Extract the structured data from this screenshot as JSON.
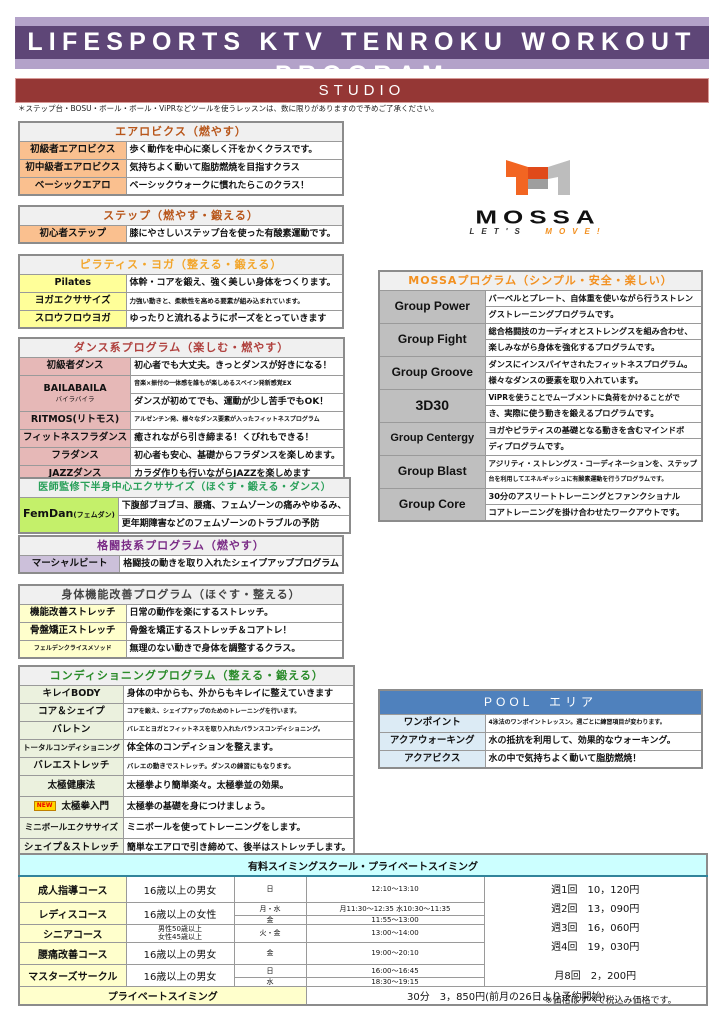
{
  "title": "LIFESPORTS KTV TENROKU WORKOUT PROGRAM",
  "studio": {
    "label": "STUDIO",
    "note": "＊ステップ台・BOSU・ボール・ボール・ViPRなどツールを使うレッスンは、数に限りがありますので予めご了承ください。"
  },
  "aerobics": {
    "header": "エアロビクス（燃やす）",
    "rows": [
      {
        "name": "初級者エアロビクス",
        "desc": "歩く動作を中心に楽しく汗をかくクラスです。"
      },
      {
        "name": "初中級者エアロビクス",
        "desc": "気持ちよく動いて脂肪燃焼を目指すクラス"
      },
      {
        "name": "ベーシックエアロ",
        "desc": "ベーシックウォークに慣れたらこのクラス！"
      }
    ]
  },
  "step": {
    "header": "ステップ（燃やす・鍛える）",
    "rows": [
      {
        "name": "初心者ステップ",
        "desc": "膝にやさしいステップ台を使った有酸素運動です。"
      }
    ]
  },
  "pilates": {
    "header": "ピラティス・ヨガ（整える・鍛える）",
    "rows": [
      {
        "name": "Pilates",
        "desc": "体幹・コアを鍛え、強く美しい身体をつくります。"
      },
      {
        "name": "ヨガエクササイズ",
        "desc": "力強い動きと、柔軟性を高める要素が組み込まれています。"
      },
      {
        "name": "スロウフロウヨガ",
        "desc": "ゆったりと流れるようにポーズをとっていきます"
      }
    ]
  },
  "dance": {
    "header": "ダンス系プログラム（楽しむ・燃やす）",
    "rows": [
      {
        "name": "初級者ダンス",
        "desc": "初心者でも大丈夫。きっとダンスが好きになる！"
      },
      {
        "name": "BAILABAILA",
        "sub": "バイラバイラ",
        "desc": "音楽×振付の一体感を誰もが楽しめるスペイン発新感覚EX",
        "desc2": "ダンスが初めてでも、運動が少し苦手でもOK！"
      },
      {
        "name": "RITMOS(リトモス)",
        "desc": "アルゼンチン発、様々なダンス要素が入ったフィットネスプログラム"
      },
      {
        "name": "フィットネスフラダンス",
        "desc": "癒されながら引き締まる！くびれもできる！"
      },
      {
        "name": "フラダンス",
        "desc": "初心者も安心、基礎からフラダンスを楽しめます。"
      },
      {
        "name": "JAZZダンス",
        "desc": "カラダ作りも行いながらJAZZを楽しめます"
      }
    ]
  },
  "femdan": {
    "header": "医師監修下半身中心エクササイズ（ほぐす・鍛える・ダンス）",
    "name": "FemDan",
    "name_sub": "(フェムダン)",
    "desc1": "下腹部ブヨブヨ、腰痛、フェムゾーンの痛みやゆるみ、",
    "desc2": "更年期障害などのフェムゾーンのトラブルの予防"
  },
  "martial": {
    "header": "格闘技系プログラム（燃やす）",
    "rows": [
      {
        "name": "マーシャルビート",
        "desc": "格闘技の動きを取り入れたシェイプアッププログラム"
      }
    ]
  },
  "body": {
    "header": "身体機能改善プログラム（ほぐす・整える）",
    "rows": [
      {
        "name": "機能改善ストレッチ",
        "desc": "日常の動作を楽にするストレッチ。"
      },
      {
        "name": "骨盤矯正ストレッチ",
        "desc": "骨盤を矯正するストレッチ＆コアトレ！"
      },
      {
        "name": "フェルデンクライスメソッド",
        "desc": "無理のない動きで身体を調整するクラス。"
      }
    ]
  },
  "conditioning": {
    "header": "コンディショニングプログラム（整える・鍛える）",
    "new_badge": "NEW",
    "rows": [
      {
        "name": "キレイBODY",
        "desc": "身体の中からも、外からもキレイに整えていきます"
      },
      {
        "name": "コア＆シェイプ",
        "desc": "コアを鍛え、シェイプアップのためのトレーニングを行います。"
      },
      {
        "name": "バレトン",
        "desc": "バレエとヨガとフィットネスを取り入れたバランスコンディショニング。"
      },
      {
        "name": "トータルコンディショニング",
        "desc": "体全体のコンディションを整えます。"
      },
      {
        "name": "バレエストレッチ",
        "desc": "バレエの動きでストレッチ。ダンスの練習にもなります。"
      },
      {
        "name": "太極健康法",
        "desc": "太極拳より簡単楽々。太極拳並の効果。"
      },
      {
        "name": "太極拳入門",
        "desc": "太極拳の基礎を身につけましょう。",
        "is_new": true
      },
      {
        "name": "ミニボールエクササイズ",
        "desc": "ミニボールを使ってトレーニングをします。"
      },
      {
        "name": "シェイプ＆ストレッチ",
        "desc": "簡単なエアロで引き締めて、後半はストレッチします。"
      }
    ]
  },
  "mossa_logo": {
    "brand": "MOSSA",
    "tag_dark": "LET'S",
    "tag_accent": "MOVE!"
  },
  "mossa": {
    "header": "MOSSAプログラム（シンプル・安全・楽しい）",
    "rows": [
      {
        "name": "Group Power",
        "desc1": "バーベルとプレート、自体重を使いながら行うストレン",
        "desc2": "グストレーニングプログラムです。"
      },
      {
        "name": "Group Fight",
        "desc1": "総合格闘技のカーディオとストレングスを組み合わせ、",
        "desc2": "楽しみながら身体を強化するプログラムです。"
      },
      {
        "name": "Group Groove",
        "desc1": "ダンスにインスパイヤされたフィットネスプログラム。",
        "desc2": "様々なダンスの要素を取り入れています。"
      },
      {
        "name": "3D30",
        "desc1": "ViPRを使うことでムーブメントに負荷をかけることがで",
        "desc2": "き、実際に使う動きを鍛えるプログラムです。"
      },
      {
        "name": "Group Centergy",
        "desc1": "ヨガやピラティスの基礎となる動きを含むマインドボ",
        "desc2": "ディプログラムです。"
      },
      {
        "name": "Group Blast",
        "desc1": "アジリティ・ストレングス・コーディネーションを、ステップ",
        "desc2": "台を利用してエネルギッシュに有酸素運動を行うプログラムです。"
      },
      {
        "name": "Group Core",
        "desc1": "30分のアスリートトレーニングとファンクショナル",
        "desc2": "コアトレーニングを掛け合わせたワークアウトです。"
      }
    ]
  },
  "pool": {
    "header": "POOL　エリア",
    "rows": [
      {
        "name": "ワンポイント",
        "desc": "4泳法のワンポイントレッスン。週ごとに練習項目が変わります。"
      },
      {
        "name": "アクアウォーキング",
        "desc": "水の抵抗を利用して、効果的なウォーキング。"
      },
      {
        "name": "アクアビクス",
        "desc": "水の中で気持ちよく動いて脂肪燃焼！"
      }
    ]
  },
  "swim": {
    "header": "有料スイミングスクール・プライベートスイミング",
    "courses": [
      {
        "name": "成人指導コース",
        "age": "16歳以上の男女",
        "day": "日",
        "time": "12:10〜13:10"
      },
      {
        "name": "レディスコース",
        "age": "16歳以上の女性",
        "day1": "月・水",
        "time1": "月11:30〜12:35  水10:30〜11:35",
        "day2": "金",
        "time2": "11:55〜13:00"
      },
      {
        "name": "シニアコース",
        "age1": "男性50歳以上",
        "age2": "女性45歳以上",
        "day": "火・金",
        "time": "13:00〜14:00"
      },
      {
        "name": "腰痛改善コース",
        "age": "16歳以上の男女",
        "day": "金",
        "time": "19:00〜20:10"
      },
      {
        "name": "マスターズサークル",
        "age": "16歳以上の男女",
        "day1": "日",
        "time1": "16:00〜16:45",
        "day2": "水",
        "time2": "18:30〜19:15"
      }
    ],
    "prices": [
      "週1回　10，120円",
      "週2回　13，090円",
      "週3回　16，060円",
      "週4回　19，030円"
    ],
    "masters_price": "月8回　2，200円",
    "private_label": "プライベートスイミング",
    "private_price": "30分　3，850円(前月の26日より予約開始)",
    "tax_note": "※価格はすべて税込み価格です。"
  }
}
